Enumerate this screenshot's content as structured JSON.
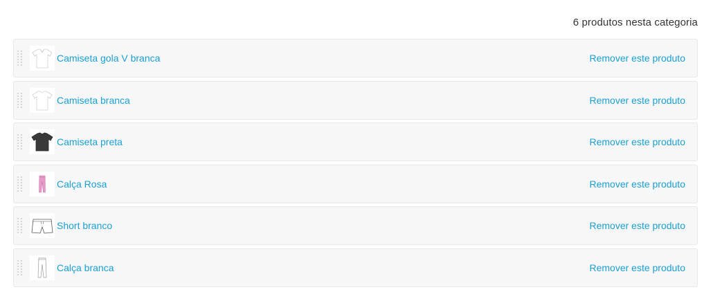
{
  "header": {
    "count_text": "6 produtos nesta categoria"
  },
  "colors": {
    "link": "#1aa0d3",
    "row_bg": "#f7f7f7",
    "row_border": "#e8e8e8"
  },
  "products": [
    {
      "name": "Camiseta gola V branca",
      "remove_label": "Remover este produto",
      "thumb_icon": "white-v-neck-tshirt-icon"
    },
    {
      "name": "Camiseta branca",
      "remove_label": "Remover este produto",
      "thumb_icon": "white-tshirt-icon"
    },
    {
      "name": "Camiseta preta",
      "remove_label": "Remover este produto",
      "thumb_icon": "black-tshirt-icon"
    },
    {
      "name": "Calça Rosa",
      "remove_label": "Remover este produto",
      "thumb_icon": "pink-pants-icon"
    },
    {
      "name": "Short branco",
      "remove_label": "Remover este produto",
      "thumb_icon": "white-shorts-icon"
    },
    {
      "name": "Calça branca",
      "remove_label": "Remover este produto",
      "thumb_icon": "white-pants-icon"
    }
  ]
}
